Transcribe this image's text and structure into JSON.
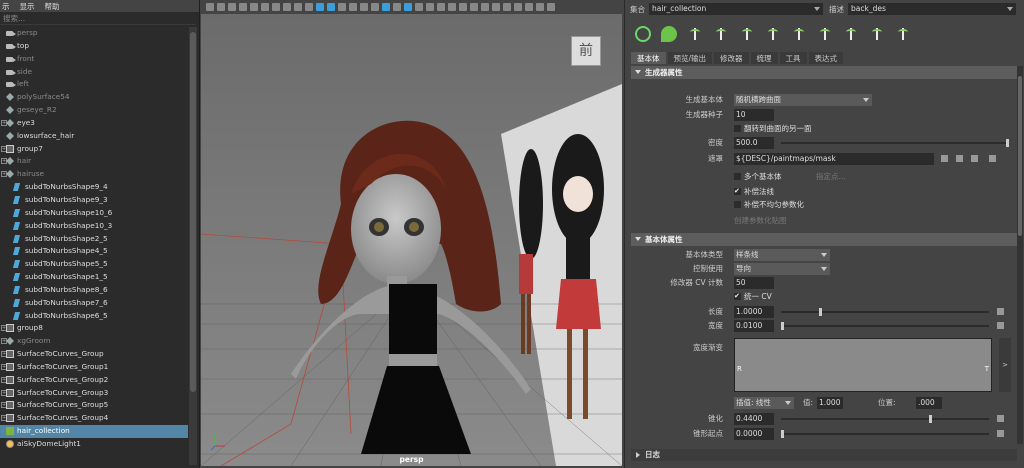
{
  "outliner": {
    "menu": [
      "示",
      "显示",
      "帮助"
    ],
    "search_placeholder": "搜索...",
    "items": [
      {
        "label": "persp",
        "icon": "camera-icon",
        "dim": true,
        "expander": false,
        "indent": 0
      },
      {
        "label": "top",
        "icon": "camera-icon",
        "dim": false,
        "expander": false,
        "indent": 0
      },
      {
        "label": "front",
        "icon": "camera-icon",
        "dim": true,
        "expander": false,
        "indent": 0
      },
      {
        "label": "side",
        "icon": "camera-icon",
        "dim": true,
        "expander": false,
        "indent": 0
      },
      {
        "label": "left",
        "icon": "camera-icon",
        "dim": true,
        "expander": false,
        "indent": 0
      },
      {
        "label": "polySurface54",
        "icon": "poly-icon",
        "dim": true,
        "expander": false,
        "indent": 0
      },
      {
        "label": "geseye_R2",
        "icon": "poly-icon",
        "dim": true,
        "expander": false,
        "indent": 0
      },
      {
        "label": "eye3",
        "icon": "transform-icon",
        "dim": false,
        "expander": true,
        "indent": 0
      },
      {
        "label": "lowsurface_hair",
        "icon": "transform-icon",
        "dim": false,
        "expander": false,
        "indent": 0
      },
      {
        "label": "group7",
        "icon": "group-icon",
        "dim": false,
        "expander": true,
        "indent": 0
      },
      {
        "label": "hair",
        "icon": "transform-icon",
        "dim": true,
        "expander": true,
        "indent": 0
      },
      {
        "label": "hairuse",
        "icon": "transform-icon",
        "dim": true,
        "expander": true,
        "indent": 0
      },
      {
        "label": "subdToNurbsShape9_4",
        "icon": "shape-icon",
        "dim": false,
        "expander": false,
        "indent": 1
      },
      {
        "label": "subdToNurbsShape9_3",
        "icon": "shape-icon",
        "dim": false,
        "expander": false,
        "indent": 1
      },
      {
        "label": "subdToNurbsShape10_6",
        "icon": "shape-icon",
        "dim": false,
        "expander": false,
        "indent": 1
      },
      {
        "label": "subdToNurbsShape10_3",
        "icon": "shape-icon",
        "dim": false,
        "expander": false,
        "indent": 1
      },
      {
        "label": "subdToNurbsShape2_5",
        "icon": "shape-icon",
        "dim": false,
        "expander": false,
        "indent": 1
      },
      {
        "label": "subdToNurbsShape4_5",
        "icon": "shape-icon",
        "dim": false,
        "expander": false,
        "indent": 1
      },
      {
        "label": "subdToNurbsShape5_5",
        "icon": "shape-icon",
        "dim": false,
        "expander": false,
        "indent": 1
      },
      {
        "label": "subdToNurbsShape1_5",
        "icon": "shape-icon",
        "dim": false,
        "expander": false,
        "indent": 1
      },
      {
        "label": "subdToNurbsShape8_6",
        "icon": "shape-icon",
        "dim": false,
        "expander": false,
        "indent": 1
      },
      {
        "label": "subdToNurbsShape7_6",
        "icon": "shape-icon",
        "dim": false,
        "expander": false,
        "indent": 1
      },
      {
        "label": "subdToNurbsShape6_5",
        "icon": "shape-icon",
        "dim": false,
        "expander": false,
        "indent": 1
      },
      {
        "label": "group8",
        "icon": "group-icon",
        "dim": false,
        "expander": true,
        "indent": 0
      },
      {
        "label": "xgGroom",
        "icon": "transform-icon",
        "dim": true,
        "expander": true,
        "indent": 0
      },
      {
        "label": "SurfaceToCurves_Group",
        "icon": "group-icon",
        "dim": false,
        "expander": true,
        "indent": 0
      },
      {
        "label": "SurfaceToCurves_Group1",
        "icon": "group-icon",
        "dim": false,
        "expander": true,
        "indent": 0
      },
      {
        "label": "SurfaceToCurves_Group2",
        "icon": "group-icon",
        "dim": false,
        "expander": true,
        "indent": 0
      },
      {
        "label": "SurfaceToCurves_Group3",
        "icon": "group-icon",
        "dim": false,
        "expander": true,
        "indent": 0
      },
      {
        "label": "SurfaceToCurves_Group5",
        "icon": "group-icon",
        "dim": false,
        "expander": true,
        "indent": 0
      },
      {
        "label": "SurfaceToCurves_Group4",
        "icon": "group-icon",
        "dim": false,
        "expander": true,
        "indent": 0
      },
      {
        "label": "hair_collection",
        "icon": "xgen-icon",
        "dim": false,
        "expander": false,
        "indent": 0,
        "selected": true
      },
      {
        "label": "aiSkyDomeLight1",
        "icon": "skydome-icon",
        "dim": false,
        "expander": false,
        "indent": 0
      }
    ]
  },
  "viewport": {
    "cube_label": "前",
    "camera_label": "persp"
  },
  "attr": {
    "collection_label": "集合",
    "collection_value": "hair_collection",
    "desc_label": "描述",
    "desc_value": "back_des",
    "tabs": [
      "基本体",
      "预览/输出",
      "修改器",
      "梳理",
      "工具",
      "表达式"
    ],
    "sec1": "生成器属性",
    "gen_primitive_label": "生成基本体",
    "gen_primitive_value": "随机横跨曲面",
    "seed_label": "生成器种子",
    "seed_value": "10",
    "flip_label": "翻转到曲面的另一面",
    "density_label": "密度",
    "density_value": "500.0",
    "mask_label": "遮罩",
    "mask_value": "${DESC}/paintmaps/mask",
    "multi_label": "多个基本体",
    "multi_extra": "指定点...",
    "normal_label": "补偿法线",
    "nonuniform_label": "补偿不均匀参数化",
    "create_map": "创建参数化贴图",
    "sec2": "基本体属性",
    "prim_type_label": "基本体类型",
    "prim_type_value": "样条线",
    "control_label": "控制使用",
    "control_value": "导向",
    "cv_label": "修改器 CV 计数",
    "cv_value": "50",
    "unify_label": "统一 CV",
    "length_label": "长度",
    "length_value": "1.0000",
    "width_label": "宽度",
    "width_value": "0.0100",
    "ramp_label": "宽度渐变",
    "ramp_left": "R",
    "ramp_right": "T",
    "interp_label": "插值: 线性",
    "value_label": "值:",
    "value_value": "1.000",
    "pos_label": "位置:",
    "pos_value": ".000",
    "taper_label": "锥化",
    "taper_value": "0.4400",
    "taper_start_label": "锥形起点",
    "taper_start_value": "0.0000",
    "log_label": "日志"
  }
}
